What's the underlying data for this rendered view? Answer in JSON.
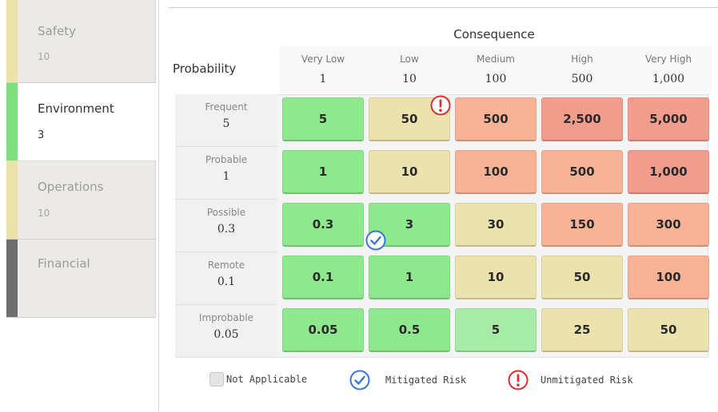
{
  "tabs": [
    {
      "name": "Safety",
      "value": "10",
      "stripe": "#ece3aa",
      "active": false
    },
    {
      "name": "Environment",
      "value": "3",
      "stripe": "#7ee07e",
      "active": true
    },
    {
      "name": "Operations",
      "value": "10",
      "stripe": "#ece3aa",
      "active": false
    },
    {
      "name": "Financial",
      "value": "",
      "stripe": "#6e6e6e",
      "active": false
    }
  ],
  "matrix": {
    "consequence_title": "Consequence",
    "probability_title": "Probability",
    "columns": [
      {
        "label": "Very Low",
        "value": "1"
      },
      {
        "label": "Low",
        "value": "10"
      },
      {
        "label": "Medium",
        "value": "100"
      },
      {
        "label": "High",
        "value": "500"
      },
      {
        "label": "Very High",
        "value": "1,000"
      }
    ],
    "rows": [
      {
        "label": "Frequent",
        "value": "5",
        "cells": [
          {
            "v": "5",
            "c": "#8ee88e"
          },
          {
            "v": "50",
            "c": "#ece2ad"
          },
          {
            "v": "500",
            "c": "#f8b296"
          },
          {
            "v": "2,500",
            "c": "#f29c8e"
          },
          {
            "v": "5,000",
            "c": "#f29c8e"
          }
        ]
      },
      {
        "label": "Probable",
        "value": "1",
        "cells": [
          {
            "v": "1",
            "c": "#8ee88e"
          },
          {
            "v": "10",
            "c": "#ece2ad"
          },
          {
            "v": "100",
            "c": "#f8b296"
          },
          {
            "v": "500",
            "c": "#f8b296"
          },
          {
            "v": "1,000",
            "c": "#f29c8e"
          }
        ]
      },
      {
        "label": "Possible",
        "value": "0.3",
        "cells": [
          {
            "v": "0.3",
            "c": "#8ee88e"
          },
          {
            "v": "3",
            "c": "#8ee88e"
          },
          {
            "v": "30",
            "c": "#ece2ad"
          },
          {
            "v": "150",
            "c": "#f8b296"
          },
          {
            "v": "300",
            "c": "#f8b296"
          }
        ]
      },
      {
        "label": "Remote",
        "value": "0.1",
        "cells": [
          {
            "v": "0.1",
            "c": "#8ee88e"
          },
          {
            "v": "1",
            "c": "#8ee88e"
          },
          {
            "v": "10",
            "c": "#ece2ad"
          },
          {
            "v": "50",
            "c": "#ece2ad"
          },
          {
            "v": "100",
            "c": "#f8b296"
          }
        ]
      },
      {
        "label": "Improbable",
        "value": "0.05",
        "cells": [
          {
            "v": "0.05",
            "c": "#8ee88e"
          },
          {
            "v": "0.5",
            "c": "#8ee88e"
          },
          {
            "v": "5",
            "c": "#a6eca6"
          },
          {
            "v": "25",
            "c": "#ece2ad"
          },
          {
            "v": "50",
            "c": "#ece2ad"
          }
        ]
      }
    ],
    "markers": [
      {
        "type": "unmitigated",
        "icon": "exclamation-icon",
        "row": 0,
        "col": 1,
        "color": "#e03030"
      },
      {
        "type": "mitigated",
        "icon": "check-icon",
        "row": 2,
        "col": 1,
        "color": "#3a78d8"
      }
    ]
  },
  "legend": {
    "not_applicable": "Not Applicable",
    "mitigated": "Mitigated Risk",
    "unmitigated": "Unmitigated Risk"
  }
}
